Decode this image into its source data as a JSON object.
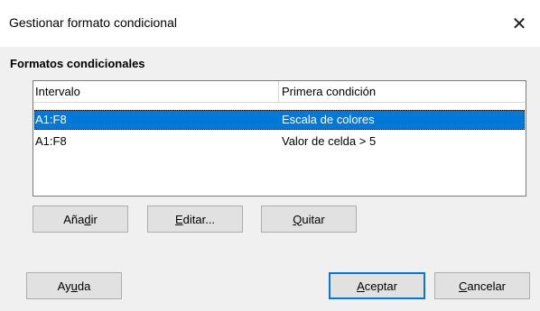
{
  "window": {
    "title": "Gestionar formato condicional",
    "close_glyph": "✕"
  },
  "section": {
    "heading": "Formatos condicionales"
  },
  "list": {
    "columns": [
      "Intervalo",
      "Primera condición"
    ],
    "rows": [
      {
        "range": "A1:F8",
        "condition": "Escala de colores",
        "selected": true
      },
      {
        "range": "A1:F8",
        "condition": "Valor de celda > 5",
        "selected": false
      }
    ]
  },
  "buttons": {
    "add": {
      "pre": "Aña",
      "mnemonic": "d",
      "post": "ir"
    },
    "edit": {
      "pre": "",
      "mnemonic": "E",
      "post": "ditar..."
    },
    "remove": {
      "pre": "",
      "mnemonic": "Q",
      "post": "uitar"
    },
    "help": {
      "pre": "Ay",
      "mnemonic": "u",
      "post": "da"
    },
    "ok": {
      "pre": "",
      "mnemonic": "A",
      "post": "ceptar"
    },
    "cancel": {
      "pre": "",
      "mnemonic": "C",
      "post": "ancelar"
    }
  },
  "colors": {
    "selection": "#0078d7",
    "default_button_border": "#0078d7"
  }
}
